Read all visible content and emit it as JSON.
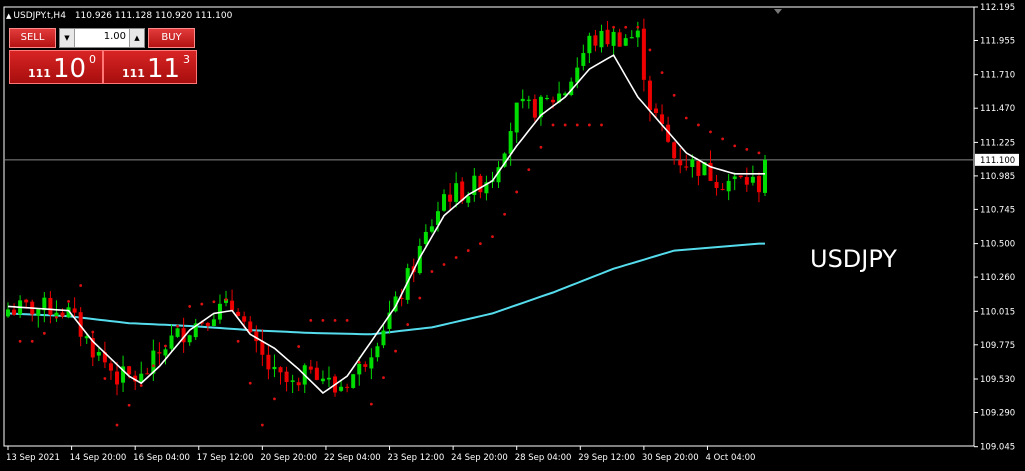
{
  "header": {
    "symbol_timeframe": "USDJPY.t,H4",
    "open": "110.926",
    "high": "111.128",
    "low": "110.920",
    "close": "111.100"
  },
  "trade_panel": {
    "sell_label": "SELL",
    "buy_label": "BUY",
    "lot_value": "1.00",
    "bid": {
      "prefix": "111",
      "main": "10",
      "sup": "0"
    },
    "ask": {
      "prefix": "111",
      "main": "11",
      "sup": "3"
    }
  },
  "symbol_label": "USDJPY",
  "current_price_label": "111.100",
  "colors": {
    "background": "#000000",
    "bull": "#00dd00",
    "bear": "#ee0000",
    "fast_ma": "#ffffff",
    "slow_ma": "#55ddee",
    "psar": "#dd1111",
    "axis": "#ffffff",
    "price_line": "#888888"
  },
  "chart_data": {
    "type": "candlestick",
    "ylim": [
      109.05,
      112.195
    ],
    "y_ticks": [
      "112.195",
      "111.955",
      "111.710",
      "111.470",
      "111.225",
      "110.985",
      "110.745",
      "110.500",
      "110.260",
      "110.015",
      "109.775",
      "109.530",
      "109.290",
      "109.045"
    ],
    "x_ticks": [
      "13 Sep 2021",
      "14 Sep 20:00",
      "16 Sep 04:00",
      "17 Sep 12:00",
      "20 Sep 20:00",
      "22 Sep 04:00",
      "23 Sep 12:00",
      "24 Sep 20:00",
      "28 Sep 04:00",
      "29 Sep 12:00",
      "30 Sep 20:00",
      "4 Oct 04:00"
    ],
    "last_price": 111.1,
    "candle_count": 126,
    "key_closes": [
      [
        0,
        110.03
      ],
      [
        8,
        110.04
      ],
      [
        10,
        110.0
      ],
      [
        14,
        109.75
      ],
      [
        18,
        109.55
      ],
      [
        22,
        109.53
      ],
      [
        26,
        109.78
      ],
      [
        30,
        109.9
      ],
      [
        34,
        110.02
      ],
      [
        38,
        110.05
      ],
      [
        40,
        109.8
      ],
      [
        44,
        109.55
      ],
      [
        48,
        109.45
      ],
      [
        50,
        109.65
      ],
      [
        54,
        109.45
      ],
      [
        58,
        109.6
      ],
      [
        62,
        109.92
      ],
      [
        64,
        110.05
      ],
      [
        68,
        110.45
      ],
      [
        72,
        110.85
      ],
      [
        76,
        110.88
      ],
      [
        80,
        111.0
      ],
      [
        84,
        111.45
      ],
      [
        88,
        111.48
      ],
      [
        92,
        111.6
      ],
      [
        96,
        111.95
      ],
      [
        100,
        111.98
      ],
      [
        104,
        111.98
      ],
      [
        106,
        111.5
      ],
      [
        110,
        111.12
      ],
      [
        114,
        111.05
      ],
      [
        118,
        110.95
      ],
      [
        122,
        110.95
      ],
      [
        124,
        110.92
      ],
      [
        125,
        111.1
      ]
    ],
    "series": [
      {
        "kind": "ma",
        "period": 6,
        "points": [
          [
            0,
            110.05
          ],
          [
            10,
            110.02
          ],
          [
            14,
            109.8
          ],
          [
            20,
            109.55
          ],
          [
            22,
            109.5
          ],
          [
            25,
            109.62
          ],
          [
            30,
            109.88
          ],
          [
            34,
            110.0
          ],
          [
            37,
            110.02
          ],
          [
            40,
            109.85
          ],
          [
            44,
            109.75
          ],
          [
            48,
            109.6
          ],
          [
            52,
            109.43
          ],
          [
            56,
            109.55
          ],
          [
            60,
            109.8
          ],
          [
            64,
            110.05
          ],
          [
            68,
            110.4
          ],
          [
            72,
            110.7
          ],
          [
            76,
            110.85
          ],
          [
            80,
            110.95
          ],
          [
            84,
            111.2
          ],
          [
            88,
            111.42
          ],
          [
            92,
            111.55
          ],
          [
            96,
            111.75
          ],
          [
            100,
            111.85
          ],
          [
            104,
            111.55
          ],
          [
            108,
            111.35
          ],
          [
            112,
            111.15
          ],
          [
            116,
            111.05
          ],
          [
            120,
            111.0
          ],
          [
            124,
            111.0
          ]
        ]
      },
      {
        "kind": "ma",
        "period": 60,
        "points": [
          [
            0,
            110.0
          ],
          [
            10,
            109.98
          ],
          [
            20,
            109.93
          ],
          [
            30,
            109.91
          ],
          [
            40,
            109.88
          ],
          [
            50,
            109.86
          ],
          [
            60,
            109.85
          ],
          [
            70,
            109.9
          ],
          [
            80,
            110.0
          ],
          [
            90,
            110.15
          ],
          [
            100,
            110.32
          ],
          [
            110,
            110.45
          ],
          [
            124,
            110.5
          ]
        ]
      },
      {
        "kind": "psar",
        "points": [
          [
            5,
            109.8
          ],
          [
            12,
            110.2
          ],
          [
            18,
            109.2
          ],
          [
            30,
            110.05
          ],
          [
            36,
            110.1
          ],
          [
            42,
            109.2
          ],
          [
            50,
            109.95
          ],
          [
            56,
            109.95
          ],
          [
            60,
            109.35
          ],
          [
            70,
            110.3
          ],
          [
            80,
            110.55
          ],
          [
            90,
            111.35
          ],
          [
            98,
            111.35
          ],
          [
            100,
            112.05
          ],
          [
            104,
            112.05
          ],
          [
            112,
            111.4
          ],
          [
            120,
            111.2
          ],
          [
            124,
            111.15
          ]
        ]
      }
    ]
  }
}
